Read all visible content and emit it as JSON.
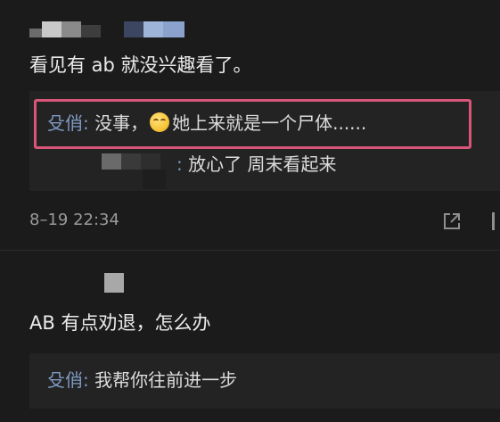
{
  "comment1": {
    "text": "看见有 ab 就没兴趣看了。",
    "replies": [
      {
        "author": "殳俏",
        "separator": ": ",
        "text_before_emoji": "没事，",
        "emoji": "smiling-face-icon",
        "text_after_emoji": "她上来就是一个尸体......"
      },
      {
        "separator": ": ",
        "text": "放心了  周末看起来"
      }
    ],
    "timestamp": "8–19  22:34"
  },
  "comment2": {
    "text": "AB 有点劝退，怎么办",
    "reply": {
      "author": "殳俏",
      "separator": ": ",
      "text": "我帮你往前进一步"
    }
  },
  "colors": {
    "background": "#1b1b1b",
    "reply_background": "#232323",
    "author_blue": "#7e9ac2",
    "highlight_pink": "#d8567a",
    "meta_gray": "#9a9a9a"
  }
}
